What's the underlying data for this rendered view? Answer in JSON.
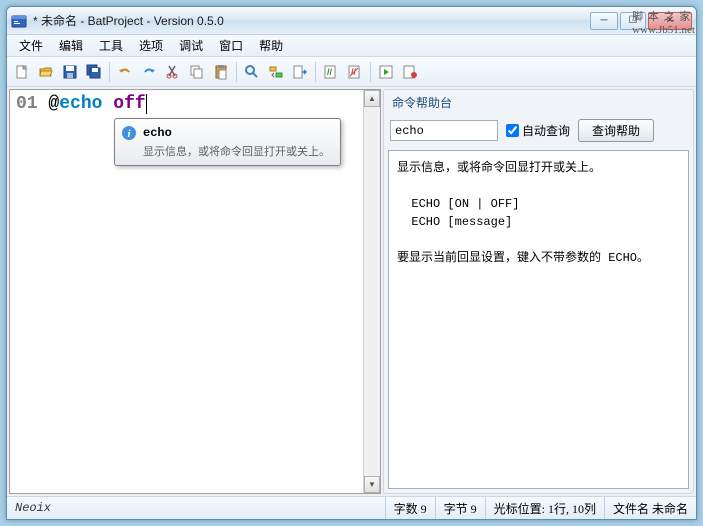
{
  "title": "* 未命名 - BatProject - Version 0.5.0",
  "watermark_top": "脚 本 之 家",
  "watermark_bottom": "www.Jb51.net",
  "menu": [
    "文件",
    "编辑",
    "工具",
    "选项",
    "调试",
    "窗口",
    "帮助"
  ],
  "editor": {
    "line_no": "01",
    "at": "@",
    "keyword": "echo",
    "arg": "off"
  },
  "tooltip": {
    "title": "echo",
    "desc": "显示信息，或将命令回显打开或关上。"
  },
  "help": {
    "group_title": "命令帮助台",
    "input_value": "echo",
    "auto_query_label": "自动查询",
    "query_btn": "查询帮助",
    "body": "显示信息，或将命令回显打开或关上。\n\n  ECHO [ON | OFF]\n  ECHO [message]\n\n要显示当前回显设置，键入不带参数的 ECHO。"
  },
  "status": {
    "left": "Neoix",
    "chars": "字数 9",
    "bytes": "字节 9",
    "cursor": "光标位置: 1行, 10列",
    "file": "文件名 未命名"
  },
  "icons": {
    "app": "#3060b0"
  }
}
